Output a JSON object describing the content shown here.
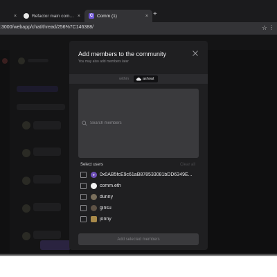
{
  "browser": {
    "tabs": [
      {
        "title": "",
        "icon": "tab-icon",
        "close": "×"
      },
      {
        "title": "Refactor main compaction co",
        "icon": "github-icon",
        "close": "×"
      },
      {
        "title": "Comm (1)",
        "icon": "comm-icon",
        "icon_text": "C",
        "close": "×"
      }
    ],
    "new_tab": "+",
    "url": ":3000/webapp/chat/thread/256%7C146388/",
    "star": "☆",
    "menu": "⋮"
  },
  "modal": {
    "title": "Add members to the community",
    "subtitle": "You may also add members later",
    "close": "×",
    "within_label": "within",
    "community_name": "ashoat",
    "search": {
      "placeholder": "Search members",
      "value": ""
    },
    "select_users_label": "Select users",
    "clear_all_label": "Clear all",
    "users": [
      {
        "name": "0x0AB5fcE9c61aB878533081bDD6349E...",
        "avatar_color": "#6e4fb8"
      },
      {
        "name": "comm.eth",
        "avatar_color": "#f4f4f4"
      },
      {
        "name": "dunny",
        "avatar_color": "#7a6f5c"
      },
      {
        "name": "ginsu",
        "avatar_color": "#5e5245"
      },
      {
        "name": "jonny",
        "avatar_color": "#a88a4a"
      }
    ],
    "add_button_label": "Add selected members"
  },
  "colors": {
    "modal_bg": "#1f1f21",
    "search_bg": "#3a3a3d",
    "accent": "#6f55d6",
    "overlay_bg": "#0f0f10"
  }
}
